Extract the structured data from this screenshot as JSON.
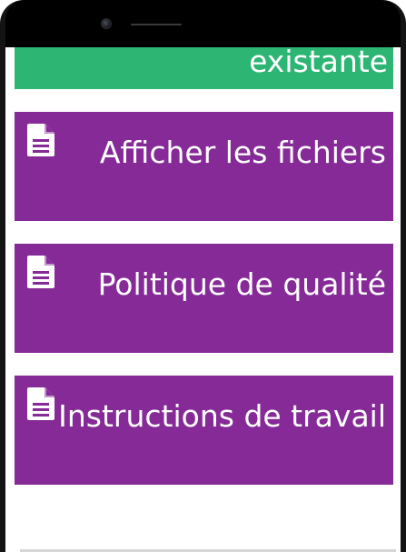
{
  "tiles": [
    {
      "label": "existante",
      "color": "#2db574",
      "icon": null
    },
    {
      "label": "Afficher les fichiers",
      "color": "#852a97",
      "icon": "document-icon"
    },
    {
      "label": "Politique de qualité",
      "color": "#852a97",
      "icon": "document-icon"
    },
    {
      "label": "Instructions de travail",
      "color": "#852a97",
      "icon": "document-icon"
    }
  ]
}
